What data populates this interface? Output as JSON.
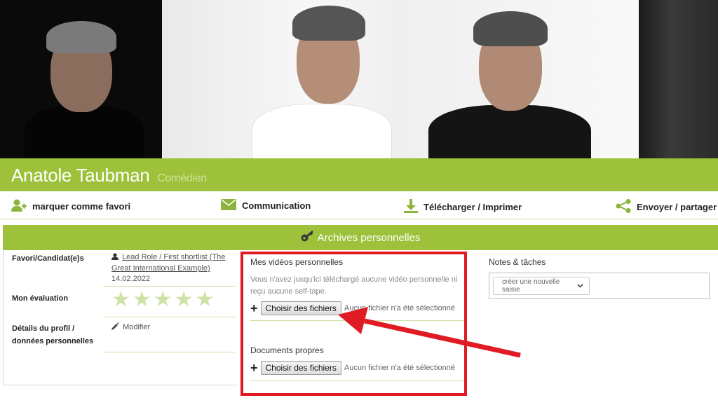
{
  "profile": {
    "name": "Anatole Taubman",
    "role": "Comédien"
  },
  "actions": [
    {
      "label": "marquer comme favori",
      "icon": "add-user-icon"
    },
    {
      "label": "Communication",
      "icon": "envelope-icon"
    },
    {
      "label": "Télécharger / Imprimer",
      "icon": "download-icon"
    },
    {
      "label": "Envoyer / partager",
      "icon": "share-icon"
    }
  ],
  "archives": {
    "title": "Archives personnelles",
    "icon": "key-icon"
  },
  "left": {
    "favori_label": "Favori/Candidat(e)s",
    "favori_link": "Lead Role / First shortlist (The Great International Example)",
    "favori_date": " 14.02.2022",
    "evaluation_label": "Mon évaluation",
    "stars": "★★★★★",
    "rating": 0,
    "details_label": "Détails du profil / données personnelles",
    "details_action": "Modifier"
  },
  "videos": {
    "title": "Mes vidéos personnelles",
    "text": "Vous n'avez jusqu'ici téléchargé aucune vidéo personnelle ni reçu aucune self-tape.",
    "button": "Choisir des fichiers",
    "status": "Aucun fichier n'a été sélectionné"
  },
  "documents": {
    "title": "Documents propres",
    "button": "Choisir des fichiers",
    "status": "Aucun fichier n'a été sélectionné"
  },
  "notes": {
    "title": "Notes & tâches",
    "select_value": "créer une nouvelle saisie"
  },
  "colors": {
    "accent": "#9dc13a",
    "highlight": "#e01b24"
  }
}
